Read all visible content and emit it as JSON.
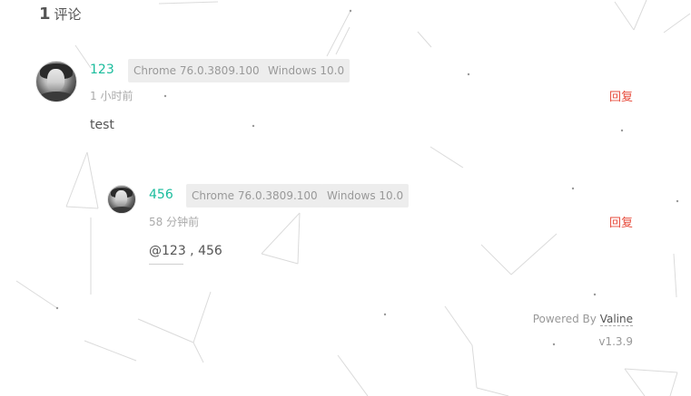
{
  "comments_count": {
    "number": "1",
    "label": "评论"
  },
  "comments": [
    {
      "nick": "123",
      "browser": "Chrome 76.0.3809.100",
      "os": "Windows 10.0",
      "time": "1 小时前",
      "reply_label": "回复",
      "content": "test"
    }
  ],
  "replies": [
    {
      "nick": "456",
      "browser": "Chrome 76.0.3809.100",
      "os": "Windows 10.0",
      "time": "58 分钟前",
      "reply_label": "回复",
      "content": "@123 , 456"
    }
  ],
  "footer": {
    "powered_prefix": "Powered By ",
    "powered_link": "Valine",
    "version": "v1.3.9"
  },
  "colors": {
    "nick": "#1abc9c",
    "reply": "#e74c3c",
    "tag_bg": "#ededed"
  }
}
